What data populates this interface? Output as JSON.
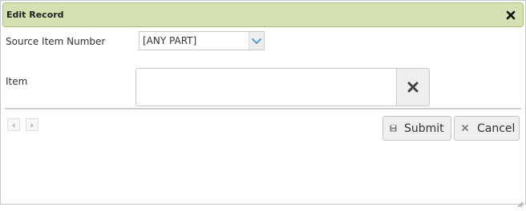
{
  "dialog": {
    "title": "Edit Record"
  },
  "form": {
    "source_item_number_label": "Source Item Number",
    "source_item_number_value": "[ANY PART]",
    "item_label": "Item",
    "item_value": ""
  },
  "buttons": {
    "submit_label": "Submit",
    "cancel_label": "Cancel"
  },
  "icons": {
    "close": "close-icon",
    "dropdown": "chevron-down-icon",
    "clear": "clear-icon",
    "prev": "triangle-left-icon",
    "next": "triangle-right-icon",
    "submit": "save-icon",
    "cancel": "close-icon",
    "resize": "resize-grip-icon"
  },
  "colors": {
    "titlebar_bg": "#d5e1b3",
    "titlebar_border": "#a9bd7a",
    "chevron": "#5b9bd5"
  }
}
